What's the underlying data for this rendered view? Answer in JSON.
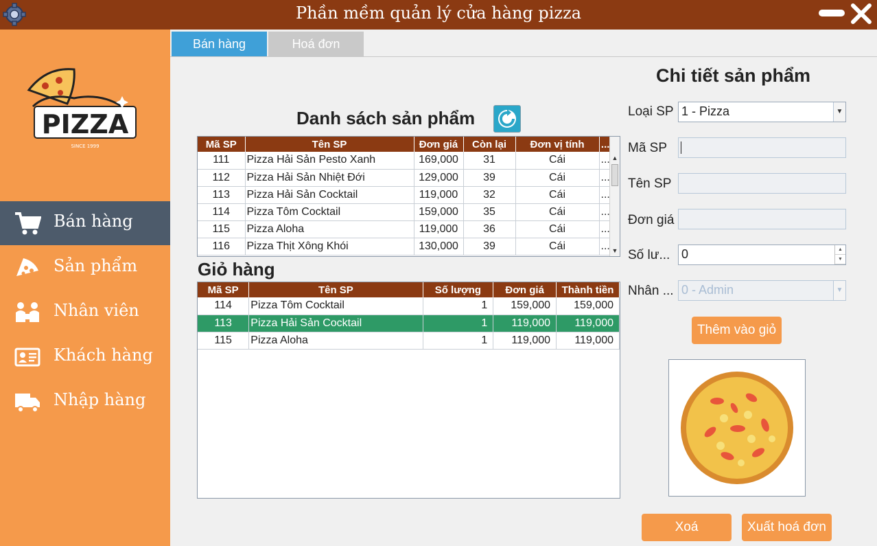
{
  "window": {
    "title": "Phần mềm quản lý cửa hàng pizza"
  },
  "colors": {
    "titlebar": "#8b3a12",
    "sidebar": "#f59a4b",
    "sidebar_active": "#4d5b6b",
    "tab_active": "#3fa0d8",
    "selected_row": "#2e9a66",
    "table_header": "#8b3a12"
  },
  "sidebar": {
    "logo": {
      "text": "PIZZA",
      "since": "SINCE 1999"
    },
    "items": [
      {
        "label": "Bán hàng",
        "icon": "cart-icon",
        "active": true
      },
      {
        "label": "Sản phẩm",
        "icon": "pizza-slice-icon",
        "active": false
      },
      {
        "label": "Nhân viên",
        "icon": "staff-icon",
        "active": false
      },
      {
        "label": "Khách hàng",
        "icon": "id-card-icon",
        "active": false
      },
      {
        "label": "Nhập hàng",
        "icon": "truck-icon",
        "active": false
      }
    ]
  },
  "tabs": [
    {
      "label": "Bán hàng",
      "active": true
    },
    {
      "label": "Hoá đơn",
      "active": false
    }
  ],
  "products": {
    "heading": "Danh sách sản phẩm",
    "columns": [
      "Mã SP",
      "Tên SP",
      "Đơn giá",
      "Còn lại",
      "Đơn vị tính",
      "..."
    ],
    "rows": [
      [
        "111",
        "Pizza Hải Sản Pesto Xanh",
        "169,000",
        "31",
        "Cái",
        "..."
      ],
      [
        "112",
        "Pizza Hải Sản Nhiệt Đới",
        "129,000",
        "39",
        "Cái",
        "..."
      ],
      [
        "113",
        "Pizza Hải Sản Cocktail",
        "119,000",
        "32",
        "Cái",
        "..."
      ],
      [
        "114",
        "Pizza Tôm Cocktail",
        "159,000",
        "35",
        "Cái",
        "..."
      ],
      [
        "115",
        "Pizza Aloha",
        "119,000",
        "36",
        "Cái",
        "..."
      ],
      [
        "116",
        "Pizza Thịt Xông Khói",
        "130,000",
        "39",
        "Cái",
        "..."
      ]
    ]
  },
  "cart": {
    "heading": "Giỏ hàng",
    "columns": [
      "Mã SP",
      "Tên SP",
      "Số lượng",
      "Đơn giá",
      "Thành tiền"
    ],
    "rows": [
      [
        "114",
        "Pizza Tôm Cocktail",
        "1",
        "159,000",
        "159,000"
      ],
      [
        "113",
        "Pizza Hải Sản Cocktail",
        "1",
        "119,000",
        "119,000"
      ],
      [
        "115",
        "Pizza Aloha",
        "1",
        "119,000",
        "119,000"
      ]
    ],
    "selected_index": 1
  },
  "detail": {
    "heading": "Chi tiết sản phẩm",
    "labels": {
      "category": "Loại SP",
      "code": "Mã SP",
      "name": "Tên SP",
      "price": "Đơn giá",
      "quantity": "Số lư...",
      "staff": "Nhân ..."
    },
    "values": {
      "category": "1 - Pizza",
      "code": "",
      "name": "",
      "price": "",
      "quantity": "0",
      "staff": "0 - Admin"
    },
    "add_button": "Thêm vào giỏ",
    "delete_button": "Xoá",
    "export_button": "Xuất hoá đơn"
  }
}
